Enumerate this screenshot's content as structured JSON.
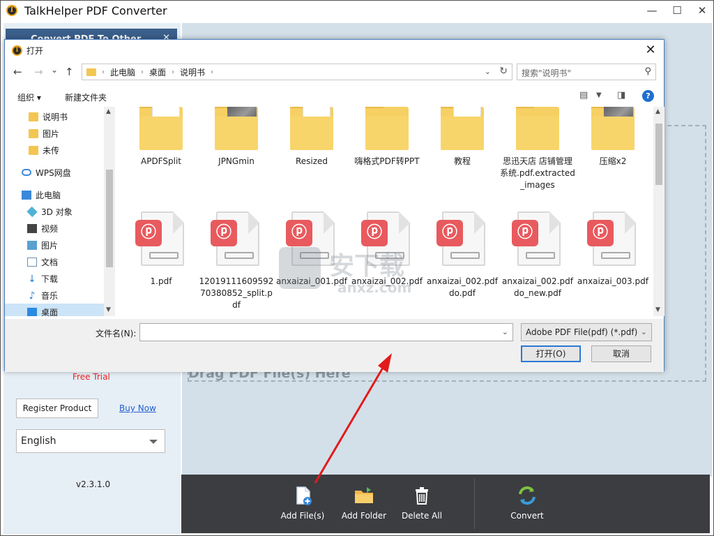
{
  "app": {
    "title": "TalkHelper PDF Converter",
    "logo_glyph": "T",
    "minimize": "—",
    "maximize": "☐",
    "close": "✕"
  },
  "sidebar": {
    "header": "Convert PDF To Other Files",
    "header_close": "✕",
    "free_trial": "Free Trial",
    "register_label": "Register Product",
    "buy_now": "Buy Now",
    "language": "English",
    "version": "v2.3.1.0"
  },
  "main": {
    "drop_text": "Drag PDF File(s) Here"
  },
  "toolbar": {
    "add_files": "Add File(s)",
    "add_folder": "Add Folder",
    "delete_all": "Delete All",
    "convert": "Convert"
  },
  "dialog": {
    "title": "打开",
    "close": "✕",
    "nav": {
      "back": "←",
      "forward": "→",
      "recent": "⌄",
      "up": "↑",
      "crumbs": [
        "此电脑",
        "桌面",
        "说明书"
      ],
      "refresh": "↻",
      "search_placeholder": "搜索\"说明书\""
    },
    "cmd": {
      "organize": "组织 ▾",
      "new_folder": "新建文件夹"
    },
    "nav_pane": [
      {
        "label": "说明书",
        "icon": "folder-icon"
      },
      {
        "label": "图片",
        "icon": "folder-icon"
      },
      {
        "label": "未传",
        "icon": "folder-icon"
      },
      {
        "label": "WPS网盘",
        "icon": "cloud-icon"
      },
      {
        "label": "此电脑",
        "icon": "computer-icon"
      },
      {
        "label": "3D 对象",
        "icon": "cube-icon"
      },
      {
        "label": "视频",
        "icon": "video-icon"
      },
      {
        "label": "图片",
        "icon": "picture-icon"
      },
      {
        "label": "文档",
        "icon": "document-icon"
      },
      {
        "label": "下载",
        "icon": "download-icon"
      },
      {
        "label": "音乐",
        "icon": "music-icon"
      },
      {
        "label": "桌面",
        "icon": "desktop-icon"
      }
    ],
    "folders": [
      {
        "name": "APDFSplit",
        "kind": "paper"
      },
      {
        "name": "JPNGmin",
        "kind": "photo"
      },
      {
        "name": "Resized",
        "kind": "paper"
      },
      {
        "name": "嗨格式PDF转PPT",
        "kind": "plain"
      },
      {
        "name": "教程",
        "kind": "paper"
      },
      {
        "name": "思迅天店 店铺管理系统.pdf.extracted_images",
        "kind": "plain"
      },
      {
        "name": "压缩x2",
        "kind": "photo"
      }
    ],
    "files": [
      {
        "name": "1.pdf"
      },
      {
        "name": "1201911160959270380852_split.pdf"
      },
      {
        "name": "anxaizai_001.pdf"
      },
      {
        "name": "anxaizai_002.pdf"
      },
      {
        "name": "anxaizai_002.pdfdo.pdf"
      },
      {
        "name": "anxaizai_002.pdfdo_new.pdf"
      },
      {
        "name": "anxaizai_003.pdf"
      }
    ],
    "filename_label": "文件名(N):",
    "filename_value": "",
    "filetype": "Adobe PDF File(pdf) (*.pdf)",
    "open_btn": "打开(O)",
    "cancel_btn": "取消"
  },
  "watermark": {
    "text": "安下载",
    "sub": "anxz.com"
  },
  "colors": {
    "accent": "#2b78d4",
    "sidebar_header": "#3b5f8c",
    "toolbar_bg": "#3b3d40",
    "pdf_badge": "#e85a5e",
    "arrow": "#e21b1b"
  }
}
